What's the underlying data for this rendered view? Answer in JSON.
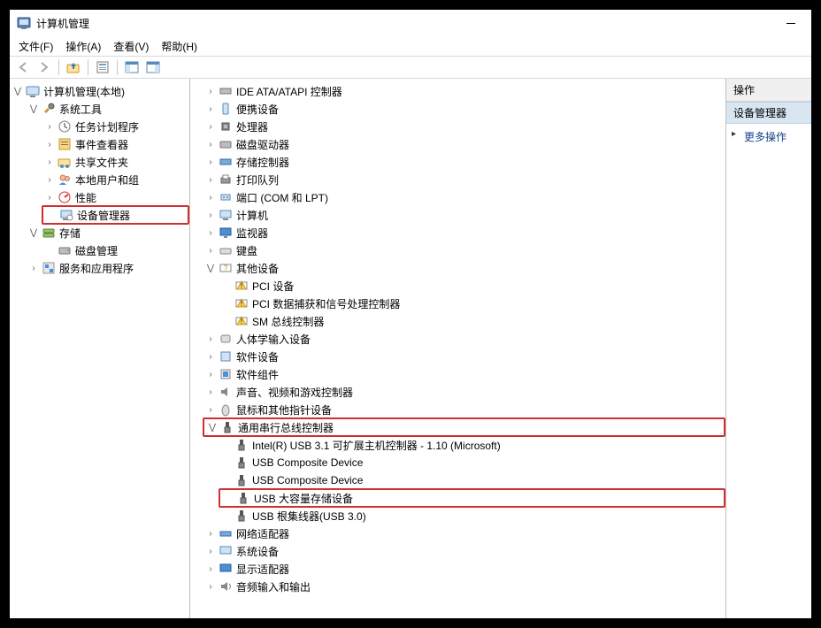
{
  "window": {
    "title": "计算机管理",
    "minimize": "—"
  },
  "menu": {
    "file": "文件(F)",
    "action": "操作(A)",
    "view": "查看(V)",
    "help": "帮助(H)"
  },
  "toolbar": {
    "back": "back",
    "forward": "forward",
    "up": "up",
    "props": "properties",
    "pane1": "pane-toggle-1",
    "pane2": "pane-toggle-2"
  },
  "left_tree": {
    "root": "计算机管理(本地)",
    "system_tools": "系统工具",
    "task_scheduler": "任务计划程序",
    "event_viewer": "事件查看器",
    "shared_folders": "共享文件夹",
    "local_users": "本地用户和组",
    "performance": "性能",
    "device_manager": "设备管理器",
    "storage": "存储",
    "disk_management": "磁盘管理",
    "services_apps": "服务和应用程序"
  },
  "center_tree": {
    "ide": "IDE ATA/ATAPI 控制器",
    "portable": "便携设备",
    "cpu": "处理器",
    "disk_drives": "磁盘驱动器",
    "storage_controllers": "存储控制器",
    "print_queues": "打印队列",
    "ports": "端口 (COM 和 LPT)",
    "computer": "计算机",
    "monitors": "监视器",
    "keyboards": "键盘",
    "other_devices": "其他设备",
    "other_pci": "PCI 设备",
    "other_pci_sig": "PCI 数据捕获和信号处理控制器",
    "other_sm": "SM 总线控制器",
    "hid": "人体学输入设备",
    "software_devices": "软件设备",
    "software_components": "软件组件",
    "sound": "声音、视频和游戏控制器",
    "mice": "鼠标和其他指针设备",
    "usb_controllers": "通用串行总线控制器",
    "usb_intel": "Intel(R) USB 3.1 可扩展主机控制器 - 1.10 (Microsoft)",
    "usb_comp1": "USB Composite Device",
    "usb_comp2": "USB Composite Device",
    "usb_mass": "USB 大容量存储设备",
    "usb_root": "USB 根集线器(USB 3.0)",
    "network": "网络适配器",
    "system_devices": "系统设备",
    "display": "显示适配器",
    "audio_io": "音频输入和输出"
  },
  "actions": {
    "header": "操作",
    "selected": "设备管理器",
    "more": "更多操作"
  }
}
